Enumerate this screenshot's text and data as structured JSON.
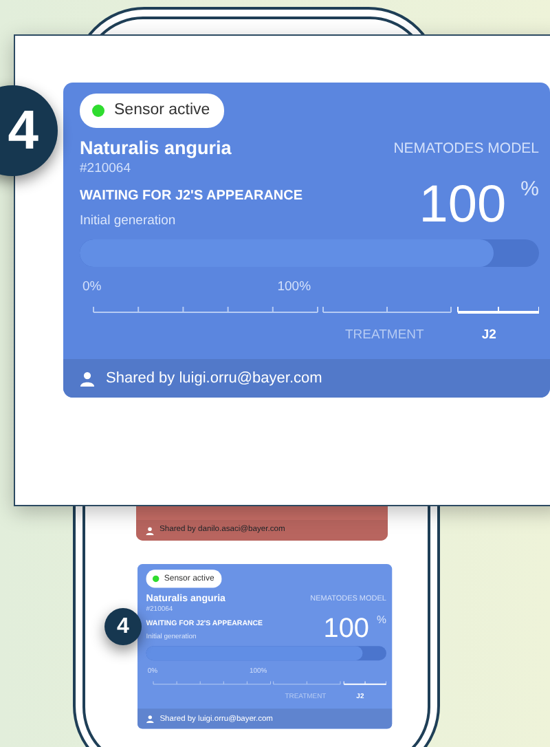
{
  "phone": {
    "cards": [
      {
        "kind": "partial",
        "color": "#c66d66",
        "shared_by": "Shared by danilo.asaci@bayer.com"
      },
      {
        "kind": "full",
        "color": "#6a93e6",
        "step_badge": "4",
        "status": {
          "label": "Sensor active",
          "active": true
        },
        "name": "Naturalis anguria",
        "id": "#210064",
        "model": "NEMATODES MODEL",
        "stage": "WAITING FOR J2'S APPEARANCE",
        "generation": "Initial generation",
        "percent": "100",
        "percent_unit": "%",
        "progress": {
          "level": 0.9
        },
        "scale_start": "0%",
        "scale_mid": "100%",
        "phases": [
          {
            "label": "TREATMENT",
            "selected": false
          },
          {
            "label": "J2",
            "selected": true
          }
        ],
        "shared_by": "Shared by luigi.orru@bayer.com"
      }
    ]
  },
  "zoom_panel": {
    "step_badge": "4",
    "card": {
      "kind": "full",
      "color": "#5b86df",
      "status": {
        "label": "Sensor active",
        "active": true
      },
      "name": "Naturalis anguria",
      "id": "#210064",
      "model": "NEMATODES MODEL",
      "stage": "WAITING FOR J2'S APPEARANCE",
      "generation": "Initial generation",
      "percent": "100",
      "percent_unit": "%",
      "progress": {
        "level": 0.9
      },
      "scale_start": "0%",
      "scale_mid": "100%",
      "phases": [
        {
          "label": "TREATMENT",
          "selected": false
        },
        {
          "label": "J2",
          "selected": true
        }
      ],
      "shared_by": "Shared by luigi.orru@bayer.com"
    }
  }
}
